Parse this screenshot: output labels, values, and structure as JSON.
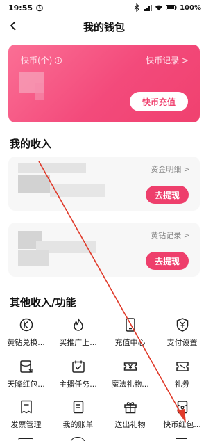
{
  "status": {
    "time": "19:55",
    "battery": "100%"
  },
  "nav": {
    "title": "我的钱包"
  },
  "coin": {
    "label": "快币(个)",
    "record": "快币记录 >",
    "recharge": "快币充值"
  },
  "income": {
    "title": "我的收入",
    "card1": {
      "link": "资金明细 >",
      "button": "去提现"
    },
    "card2": {
      "link": "黄钻记录 >",
      "button": "去提现"
    }
  },
  "other": {
    "title": "其他收入/功能",
    "items": [
      {
        "label": "黄钻兑换...",
        "icon": "yellow-diamond-exchange-icon"
      },
      {
        "label": "买推广上...",
        "icon": "flame-icon"
      },
      {
        "label": "充值中心",
        "icon": "phone-recharge-icon"
      },
      {
        "label": "支付设置",
        "icon": "yuan-shield-icon"
      },
      {
        "label": "天降红包...",
        "icon": "red-packet-icon"
      },
      {
        "label": "主播任务...",
        "icon": "calendar-check-icon"
      },
      {
        "label": "魔法礼物...",
        "icon": "magic-gift-icon"
      },
      {
        "label": "礼券",
        "icon": "coupon-icon"
      },
      {
        "label": "发票管理",
        "icon": "invoice-icon"
      },
      {
        "label": "我的账单",
        "icon": "bill-icon"
      },
      {
        "label": "送出礼物",
        "icon": "gift-icon"
      },
      {
        "label": "快币红包...",
        "icon": "coin-red-packet-icon"
      }
    ]
  },
  "colors": {
    "accent": "#f0426f",
    "card_gradient_start": "#fb6f95",
    "card_gradient_end": "#f0416f",
    "arrow": "#e03a2a"
  }
}
